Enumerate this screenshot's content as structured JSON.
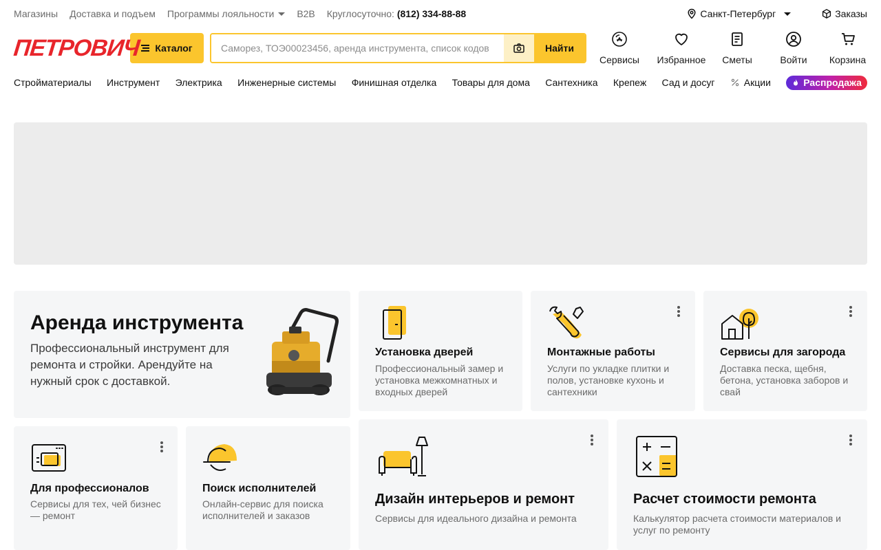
{
  "topbar": {
    "stores": "Магазины",
    "delivery": "Доставка и подъем",
    "loyalty": "Программы лояльности",
    "b2b": "B2B",
    "phone_label": "Круглосуточно:",
    "phone": "(812) 334-88-88",
    "city": "Санкт-Петербург",
    "orders": "Заказы"
  },
  "header": {
    "logo": "ПЕТРОВИЧ",
    "catalog": "Каталог",
    "search_placeholder": "Саморез, ТОЭ00023456, аренда инструмента, список кодов",
    "search_button": "Найти",
    "icons": [
      {
        "label": "Сервисы",
        "icon": "services-icon"
      },
      {
        "label": "Избранное",
        "icon": "heart-icon"
      },
      {
        "label": "Сметы",
        "icon": "document-icon"
      },
      {
        "label": "Войти",
        "icon": "user-icon"
      },
      {
        "label": "Корзина",
        "icon": "cart-icon"
      }
    ]
  },
  "nav": {
    "items": [
      "Стройматериалы",
      "Инструмент",
      "Электрика",
      "Инженерные системы",
      "Финишная отделка",
      "Товары для дома",
      "Сантехника",
      "Крепеж",
      "Сад и досуг"
    ],
    "promo": "Акции",
    "sale": "Распродажа"
  },
  "cards": {
    "rent": {
      "title": "Аренда инструмента",
      "desc": "Профессиональный инструмент для ремонта и стройки. Арендуйте на нужный срок с доставкой."
    },
    "doors": {
      "title": "Установка дверей",
      "desc": "Профессиональный замер и установка межкомнатных и входных дверей"
    },
    "mounting": {
      "title": "Монтажные работы",
      "desc": "Услуги по укладке плитки и полов, установке кухонь и сантехники"
    },
    "country": {
      "title": "Сервисы для загорода",
      "desc": "Доставка песка, щебня, бетона, установка заборов и свай"
    },
    "pros": {
      "title": "Для профессионалов",
      "desc": "Сервисы для тех, чей бизнес — ремонт"
    },
    "search": {
      "title": "Поиск исполнителей",
      "desc": "Онлайн-сервис для поиска исполнителей и заказов"
    },
    "design": {
      "title": "Дизайн интерьеров и ремонт",
      "desc": "Сервисы для идеального дизайна и ремонта"
    },
    "calc": {
      "title": "Расчет стоимости ремонта",
      "desc": "Калькулятор расчета стоимости материалов и услуг по ремонту"
    }
  },
  "colors": {
    "accent": "#fbc52d",
    "brand_red": "#e8252b",
    "card_bg": "#f5f6f7"
  }
}
